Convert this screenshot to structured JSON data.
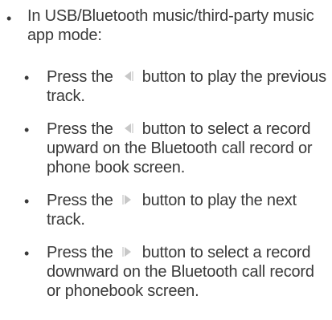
{
  "heading": {
    "bullet": "•",
    "text": "In USB/Bluetooth music/third-party music app mode:"
  },
  "items": [
    {
      "bullet": "•",
      "before": "Press the",
      "icon": "previous-track-icon",
      "after": "button to play the previous track."
    },
    {
      "bullet": "•",
      "before": "Press the",
      "icon": "previous-track-icon",
      "after": "button to select a record upward on the Bluetooth call record or phone book screen."
    },
    {
      "bullet": "•",
      "before": "Press the",
      "icon": "next-track-icon",
      "after": "button to play the next track."
    },
    {
      "bullet": "•",
      "before": "Press the",
      "icon": "next-track-icon",
      "after": "button to select a record downward on the Bluetooth call record or phonebook screen."
    }
  ],
  "colors": {
    "text": "#3a3a3a",
    "icon": "#c8c8c8"
  }
}
